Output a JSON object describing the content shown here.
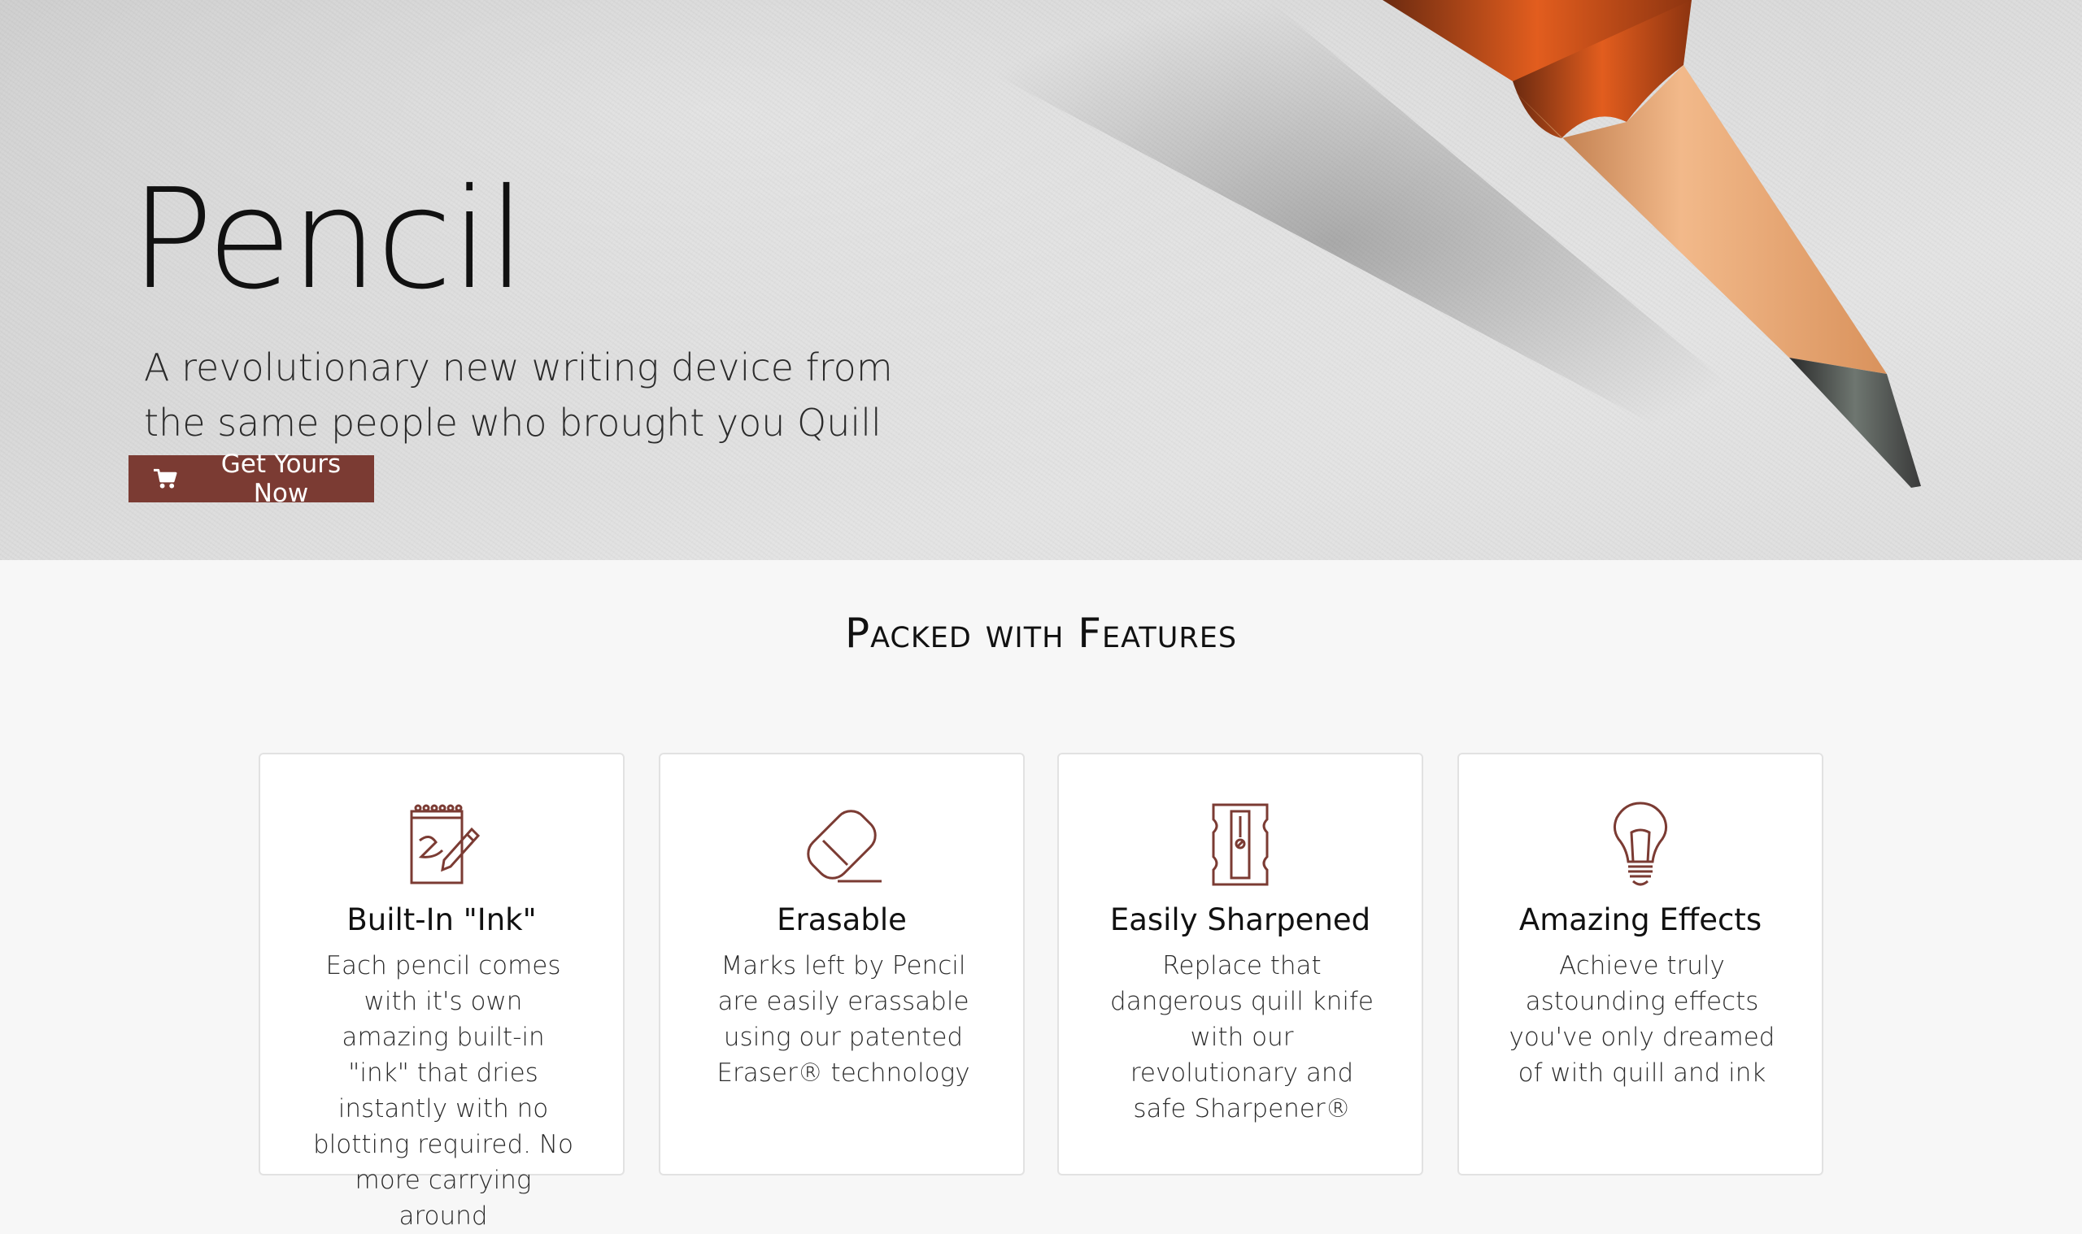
{
  "hero": {
    "title": "Pencil",
    "subtitle": "A revolutionary new writing device from the same people who brought you Quill & Ink",
    "cta_label": "Get Yours Now",
    "cta_icon": "cart-icon",
    "background_image": "pencil-on-paper-photo"
  },
  "features": {
    "heading": "Packed with Features",
    "cards": [
      {
        "icon": "notepad-pencil-icon",
        "title": "Built-In \"Ink\"",
        "text": "Each pencil comes with it's own amazing built-in \"ink\" that dries instantly with no blotting required. No more carrying around"
      },
      {
        "icon": "eraser-icon",
        "title": "Erasable",
        "text": "Marks left by Pencil are easily erassable using our patented Eraser® technology"
      },
      {
        "icon": "sharpener-icon",
        "title": "Easily Sharpened",
        "text": "Replace that dangerous quill knife with our revolutionary and safe Sharpener®"
      },
      {
        "icon": "lightbulb-icon",
        "title": "Amazing Effects",
        "text": "Achieve truly astounding effects you've only dreamed of with quill and ink"
      }
    ]
  },
  "colors": {
    "accent": "#7b3b33",
    "icon_stroke": "#7b3b33",
    "page_bg": "#f7f7f7",
    "card_bg": "#ffffff"
  }
}
